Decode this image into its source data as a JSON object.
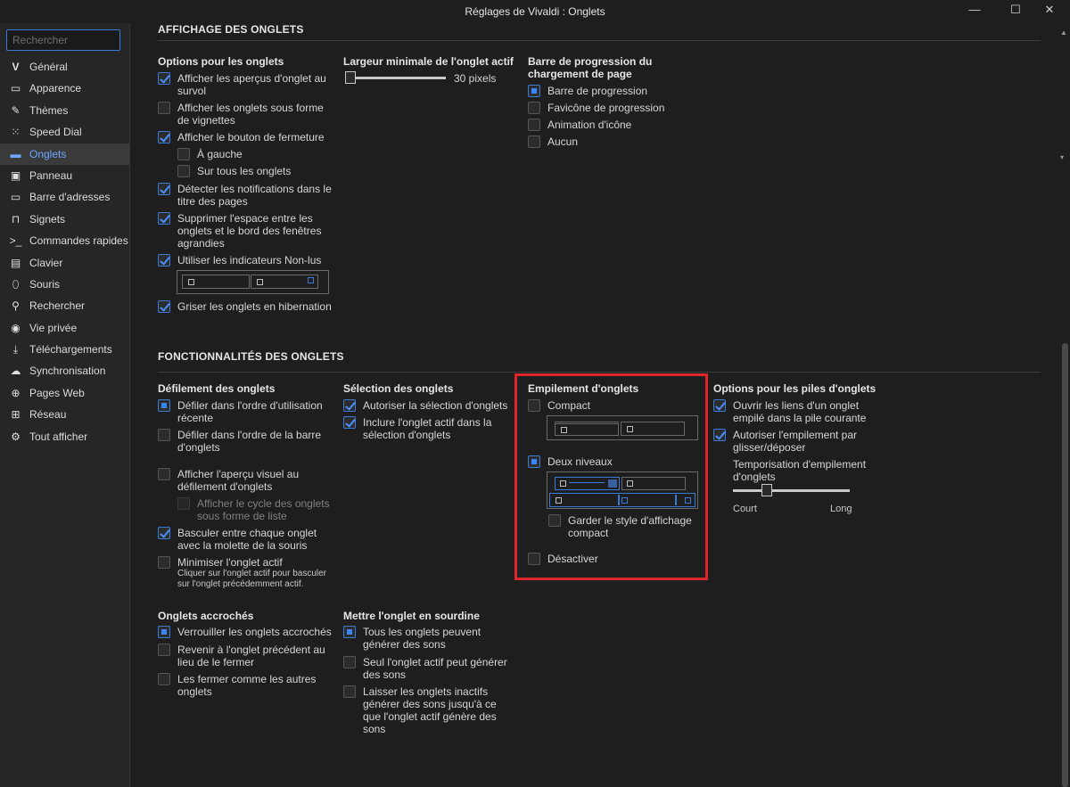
{
  "window": {
    "title": "Réglages de Vivaldi : Onglets",
    "min": "—",
    "max": "☐",
    "close": "✕"
  },
  "search": {
    "placeholder": "Rechercher"
  },
  "sidebar": {
    "items": [
      {
        "label": "Général",
        "icon": "vivaldi-logo-icon"
      },
      {
        "label": "Apparence",
        "icon": "window-icon"
      },
      {
        "label": "Thèmes",
        "icon": "brush-icon"
      },
      {
        "label": "Speed Dial",
        "icon": "grid-icon"
      },
      {
        "label": "Onglets",
        "icon": "tabs-icon"
      },
      {
        "label": "Panneau",
        "icon": "panel-icon"
      },
      {
        "label": "Barre d'adresses",
        "icon": "address-bar-icon"
      },
      {
        "label": "Signets",
        "icon": "bookmark-icon"
      },
      {
        "label": "Commandes rapides",
        "icon": "quick-commands-icon"
      },
      {
        "label": "Clavier",
        "icon": "keyboard-icon"
      },
      {
        "label": "Souris",
        "icon": "mouse-icon"
      },
      {
        "label": "Rechercher",
        "icon": "search-icon"
      },
      {
        "label": "Vie privée",
        "icon": "eye-icon"
      },
      {
        "label": "Téléchargements",
        "icon": "download-icon"
      },
      {
        "label": "Synchronisation",
        "icon": "cloud-icon"
      },
      {
        "label": "Pages Web",
        "icon": "globe-icon"
      },
      {
        "label": "Réseau",
        "icon": "network-icon"
      },
      {
        "label": "Tout afficher",
        "icon": "gear-icon"
      }
    ],
    "active": "Onglets"
  },
  "sections": {
    "display": {
      "title": "AFFICHAGE DES ONGLETS",
      "tab_options": {
        "title": "Options pour les onglets",
        "items": [
          {
            "label": "Afficher les aperçus d'onglet au survol",
            "checked": true
          },
          {
            "label": "Afficher les onglets sous forme de vignettes",
            "checked": false
          },
          {
            "label": "Afficher le bouton de fermeture",
            "checked": true
          },
          {
            "label": "À gauche",
            "checked": false
          },
          {
            "label": "Sur tous les onglets",
            "checked": false
          },
          {
            "label": "Détecter les notifications dans le titre des pages",
            "checked": true
          },
          {
            "label": "Supprimer l'espace entre les onglets et le bord des fenêtres agrandies",
            "checked": true
          },
          {
            "label": "Utiliser les indicateurs Non-lus",
            "checked": true
          },
          {
            "label": "Griser les onglets en hibernation",
            "checked": true
          }
        ]
      },
      "min_width": {
        "title": "Largeur minimale de l'onglet actif",
        "value_label": "30 pixels",
        "value": 30
      },
      "progress": {
        "title": "Barre de progression du chargement de page",
        "items": [
          {
            "label": "Barre de progression",
            "selected": true
          },
          {
            "label": "Favicône de progression",
            "selected": false
          },
          {
            "label": "Animation d'icône",
            "selected": false
          },
          {
            "label": "Aucun",
            "selected": false
          }
        ]
      }
    },
    "features": {
      "title": "FONCTIONNALITÉS DES ONGLETS",
      "scrolling": {
        "title": "Défilement des onglets",
        "items": [
          {
            "label": "Défiler dans l'ordre d'utilisation récente",
            "selected": true
          },
          {
            "label": "Défiler dans l'ordre de la barre d'onglets",
            "selected": false
          },
          {
            "label": "Afficher l'aperçu visuel au défilement d'onglets",
            "checked": false
          },
          {
            "label": "Afficher le cycle des onglets sous forme de liste",
            "checked": false
          },
          {
            "label": "Basculer entre chaque onglet avec la molette de la souris",
            "checked": true
          },
          {
            "label": "Minimiser l'onglet actif",
            "checked": false
          }
        ],
        "hint": "Cliquer sur l'onglet actif pour basculer sur l'onglet précédemment actif."
      },
      "selection": {
        "title": "Sélection des onglets",
        "items": [
          {
            "label": "Autoriser la sélection d'onglets",
            "checked": true
          },
          {
            "label": "Inclure l'onglet actif dans la sélection d'onglets",
            "checked": true
          }
        ]
      },
      "stacking": {
        "title": "Empilement d'onglets",
        "items": [
          {
            "label": "Compact",
            "selected": false
          },
          {
            "label": "Deux niveaux",
            "selected": true
          },
          {
            "label": "Garder le style d'affichage compact",
            "checked": false
          },
          {
            "label": "Désactiver",
            "selected": false
          }
        ]
      },
      "stack_options": {
        "title": "Options pour les piles d'onglets",
        "items": [
          {
            "label": "Ouvrir les liens d'un onglet empilé dans la pile courante",
            "checked": true
          },
          {
            "label": "Autoriser l'empilement par glisser/déposer",
            "checked": true
          }
        ],
        "delay_label": "Temporisation d'empilement d'onglets",
        "delay_level": 0.27,
        "short": "Court",
        "long": "Long"
      },
      "pinned": {
        "title": "Onglets accrochés",
        "items": [
          {
            "label": "Verrouiller les onglets accrochés",
            "selected": true
          },
          {
            "label": "Revenir à l'onglet précédent au lieu de le fermer",
            "selected": false
          },
          {
            "label": "Les fermer comme les autres onglets",
            "selected": false
          }
        ]
      },
      "mute": {
        "title": "Mettre l'onglet en sourdine",
        "items": [
          {
            "label": "Tous les onglets peuvent générer des sons",
            "selected": true
          },
          {
            "label": "Seul l'onglet actif peut générer des sons",
            "selected": false
          },
          {
            "label": "Laisser les onglets inactifs générer des sons jusqu'à ce que l'onglet actif génère des sons",
            "selected": false
          }
        ]
      }
    }
  },
  "colors": {
    "accent": "#3a86ff",
    "highlight": "#e0252b",
    "background": "#1e1e1e",
    "sidebar": "#262626"
  }
}
